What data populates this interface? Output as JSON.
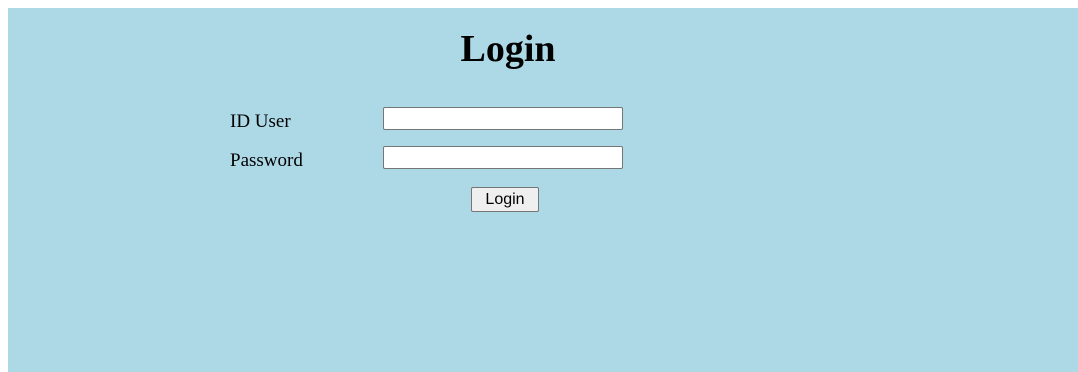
{
  "page": {
    "title": "Login",
    "background_color": "#add8e6"
  },
  "form": {
    "user_label": "ID User",
    "user_value": "",
    "password_label": "Password",
    "password_value": "",
    "submit_label": "Login"
  }
}
